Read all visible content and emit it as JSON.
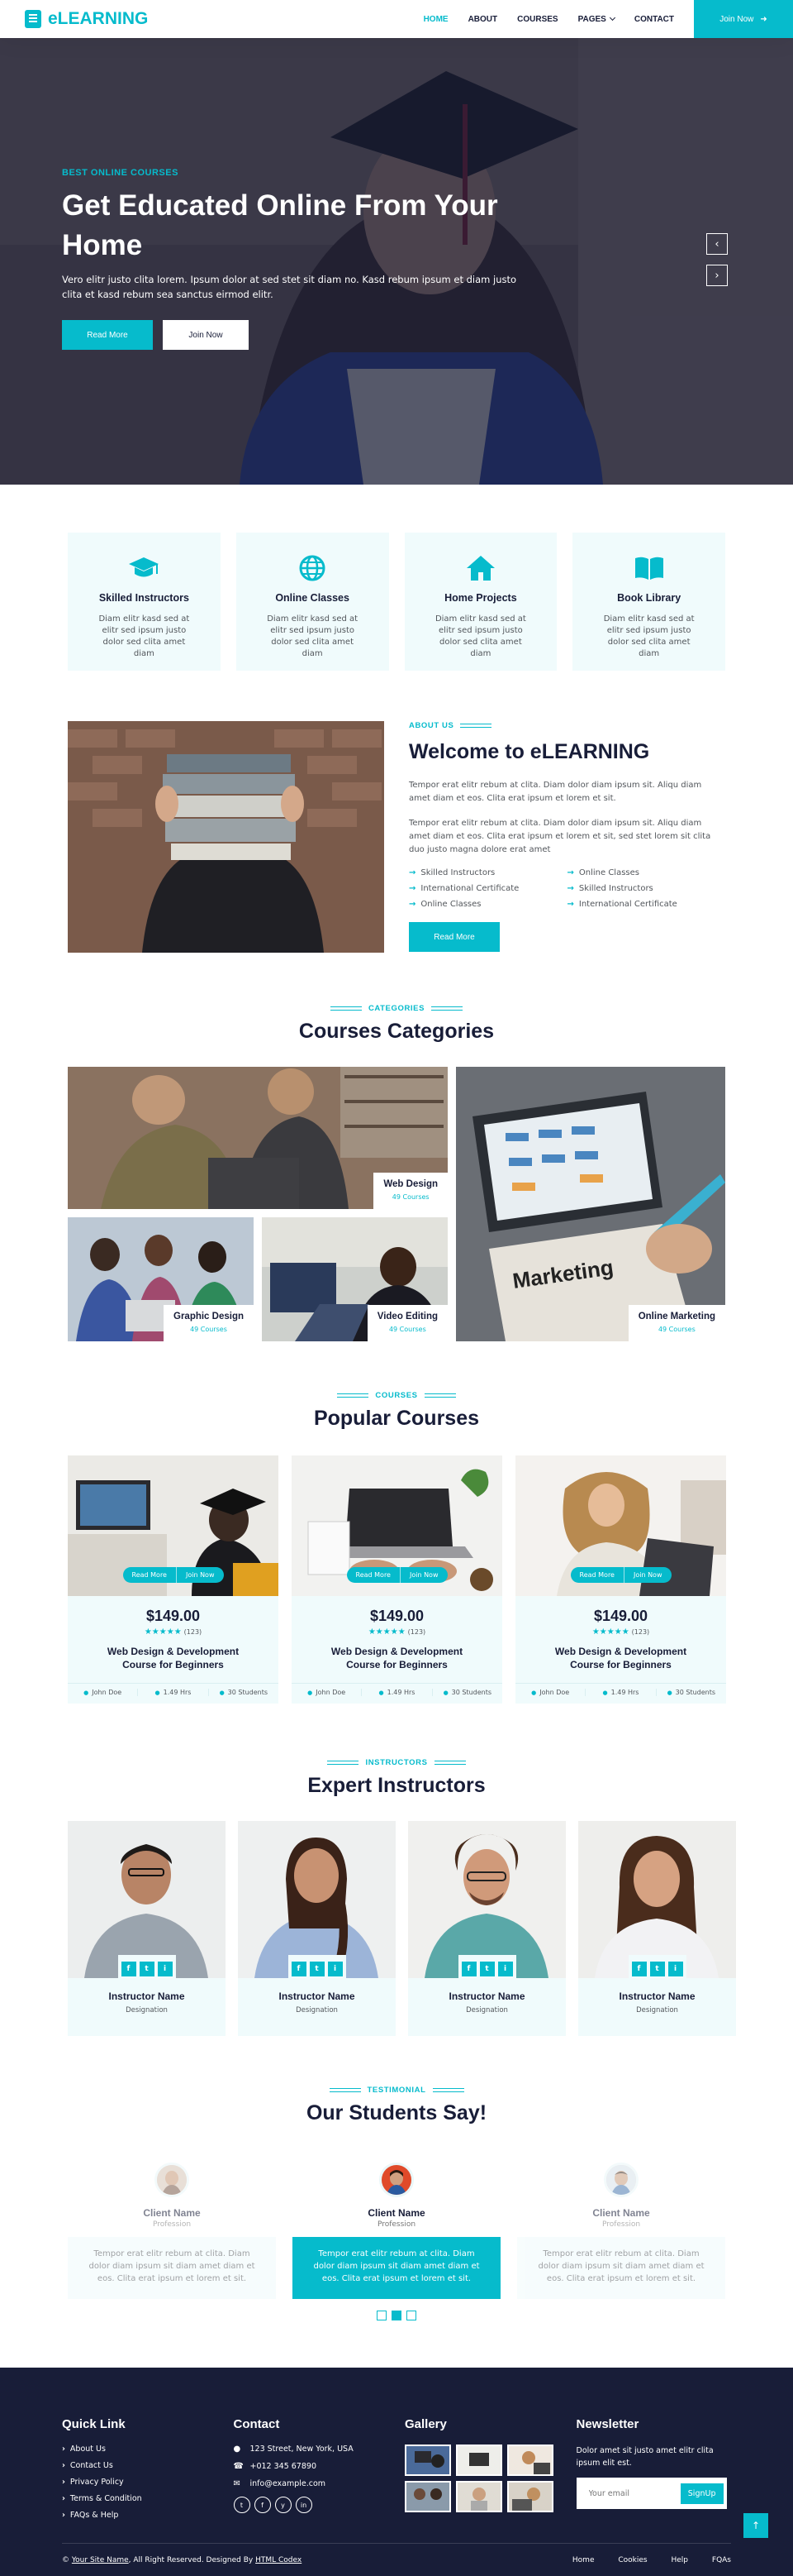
{
  "brand": {
    "name": "eLEARNING"
  },
  "nav": {
    "items": [
      "HOME",
      "ABOUT",
      "COURSES",
      "PAGES",
      "CONTACT"
    ],
    "join": "Join Now"
  },
  "hero": {
    "kicker": "BEST ONLINE COURSES",
    "title": "Get Educated Online From Your Home",
    "text": "Vero elitr justo clita lorem. Ipsum dolor at sed stet sit diam no. Kasd rebum ipsum et diam justo clita et kasd rebum sea sanctus eirmod elitr.",
    "btn_read": "Read More",
    "btn_join": "Join Now"
  },
  "services": [
    {
      "icon": "graduation-cap-icon",
      "title": "Skilled Instructors",
      "text": "Diam elitr kasd sed at elitr sed ipsum justo dolor sed clita amet diam"
    },
    {
      "icon": "globe-icon",
      "title": "Online Classes",
      "text": "Diam elitr kasd sed at elitr sed ipsum justo dolor sed clita amet diam"
    },
    {
      "icon": "home-icon",
      "title": "Home Projects",
      "text": "Diam elitr kasd sed at elitr sed ipsum justo dolor sed clita amet diam"
    },
    {
      "icon": "book-open-icon",
      "title": "Book Library",
      "text": "Diam elitr kasd sed at elitr sed ipsum justo dolor sed clita amet diam"
    }
  ],
  "about": {
    "kicker": "ABOUT US",
    "title_pre": "Welcome to ",
    "title_brand": "eLEARNING",
    "p1": "Tempor erat elitr rebum at clita. Diam dolor diam ipsum sit. Aliqu diam amet diam et eos. Clita erat ipsum et lorem et sit.",
    "p2": "Tempor erat elitr rebum at clita. Diam dolor diam ipsum sit. Aliqu diam amet diam et eos. Clita erat ipsum et lorem et sit, sed stet lorem sit clita duo justo magna dolore erat amet",
    "features": [
      "Skilled Instructors",
      "Online Classes",
      "International Certificate",
      "Skilled Instructors",
      "Online Classes",
      "International Certificate"
    ],
    "btn": "Read More"
  },
  "categories": {
    "kicker": "CATEGORIES",
    "title": "Courses Categories",
    "items": [
      {
        "name": "Web Design",
        "count": "49 Courses"
      },
      {
        "name": "Graphic Design",
        "count": "49 Courses"
      },
      {
        "name": "Video Editing",
        "count": "49 Courses"
      },
      {
        "name": "Online Marketing",
        "count": "49 Courses"
      }
    ]
  },
  "courses": {
    "kicker": "COURSES",
    "title": "Popular Courses",
    "read": "Read More",
    "join": "Join Now",
    "items": [
      {
        "price": "$149.00",
        "stars": "★★★★★",
        "reviews": "(123)",
        "title": "Web Design & Development Course for Beginners",
        "author": "John Doe",
        "hours": "1.49 Hrs",
        "students": "30 Students"
      },
      {
        "price": "$149.00",
        "stars": "★★★★★",
        "reviews": "(123)",
        "title": "Web Design & Development Course for Beginners",
        "author": "John Doe",
        "hours": "1.49 Hrs",
        "students": "30 Students"
      },
      {
        "price": "$149.00",
        "stars": "★★★★★",
        "reviews": "(123)",
        "title": "Web Design & Development Course for Beginners",
        "author": "John Doe",
        "hours": "1.49 Hrs",
        "students": "30 Students"
      }
    ]
  },
  "team": {
    "kicker": "INSTRUCTORS",
    "title": "Expert Instructors",
    "social": [
      "f",
      "t",
      "i"
    ],
    "members": [
      {
        "name": "Instructor Name",
        "role": "Designation"
      },
      {
        "name": "Instructor Name",
        "role": "Designation"
      },
      {
        "name": "Instructor Name",
        "role": "Designation"
      },
      {
        "name": "Instructor Name",
        "role": "Designation"
      }
    ]
  },
  "testimonial": {
    "kicker": "TESTIMONIAL",
    "title": "Our Students Say!",
    "items": [
      {
        "name": "Client Name",
        "prof": "Profession",
        "text": "Tempor erat elitr rebum at clita. Diam dolor diam ipsum sit diam amet diam et eos. Clita erat ipsum et lorem et sit."
      },
      {
        "name": "Client Name",
        "prof": "Profession",
        "text": "Tempor erat elitr rebum at clita. Diam dolor diam ipsum sit diam amet diam et eos. Clita erat ipsum et lorem et sit."
      },
      {
        "name": "Client Name",
        "prof": "Profession",
        "text": "Tempor erat elitr rebum at clita. Diam dolor diam ipsum sit diam amet diam et eos. Clita erat ipsum et lorem et sit."
      }
    ]
  },
  "footer": {
    "quick_title": "Quick Link",
    "quick": [
      "About Us",
      "Contact Us",
      "Privacy Policy",
      "Terms & Condition",
      "FAQs & Help"
    ],
    "contact_title": "Contact",
    "address": "123 Street, New York, USA",
    "phone": "+012 345 67890",
    "email": "info@example.com",
    "social": [
      "t",
      "f",
      "y",
      "in"
    ],
    "gallery_title": "Gallery",
    "newsletter_title": "Newsletter",
    "newsletter_text": "Dolor amet sit justo amet elitr clita ipsum elit est.",
    "email_placeholder": "Your email",
    "signup": "SignUp",
    "copy_pre": "© ",
    "site_name": "Your Site Name",
    "copy_mid": ", All Right Reserved. Designed By ",
    "designer": "HTML Codex",
    "bottom_links": [
      "Home",
      "Cookies",
      "Help",
      "FQAs"
    ]
  },
  "colors": {
    "primary": "#06BBCC",
    "dark": "#181d38",
    "light": "#f0fbfc"
  }
}
